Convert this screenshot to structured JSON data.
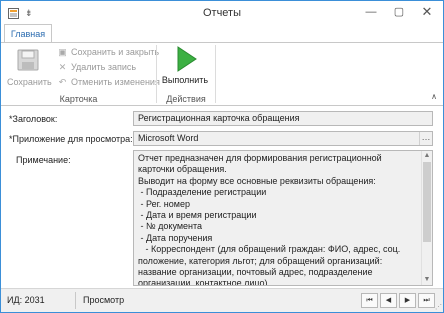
{
  "window": {
    "title": "Отчеты"
  },
  "ribbon": {
    "tab": "Главная",
    "save_label": "Сохранить",
    "save_close_label": "Сохранить и закрыть",
    "delete_label": "Удалить запись",
    "cancel_label": "Отменить изменения",
    "card_group_label": "Карточка",
    "run_label": "Выполнить",
    "actions_group_label": "Действия"
  },
  "form": {
    "title_label": "*Заголовок:",
    "title_value": "Регистрационная карточка обращения",
    "app_label": "*Приложение для просмотра:",
    "app_value": "Microsoft Word",
    "note_label": "Примечание:",
    "note_value": "Отчет предназначен для формирования регистрационной карточки обращения.\nВыводит на форму все основные реквизиты обращения:\n - Подразделение регистрации\n - Рег. номер\n - Дата и время регистрации\n - № документа\n - Дата поручения\n   - Корреспондент (для обращений граждан: ФИО, адрес, соц. положение, категория льгот; для обращений организаций: название организации, почтовый адрес, подразделение организации, контактное лицо)"
  },
  "status": {
    "id_text": "ИД: 2031",
    "mode": "Просмотр"
  },
  "colors": {
    "accent": "#3b8fd8",
    "run_icon": "#3cb043"
  }
}
